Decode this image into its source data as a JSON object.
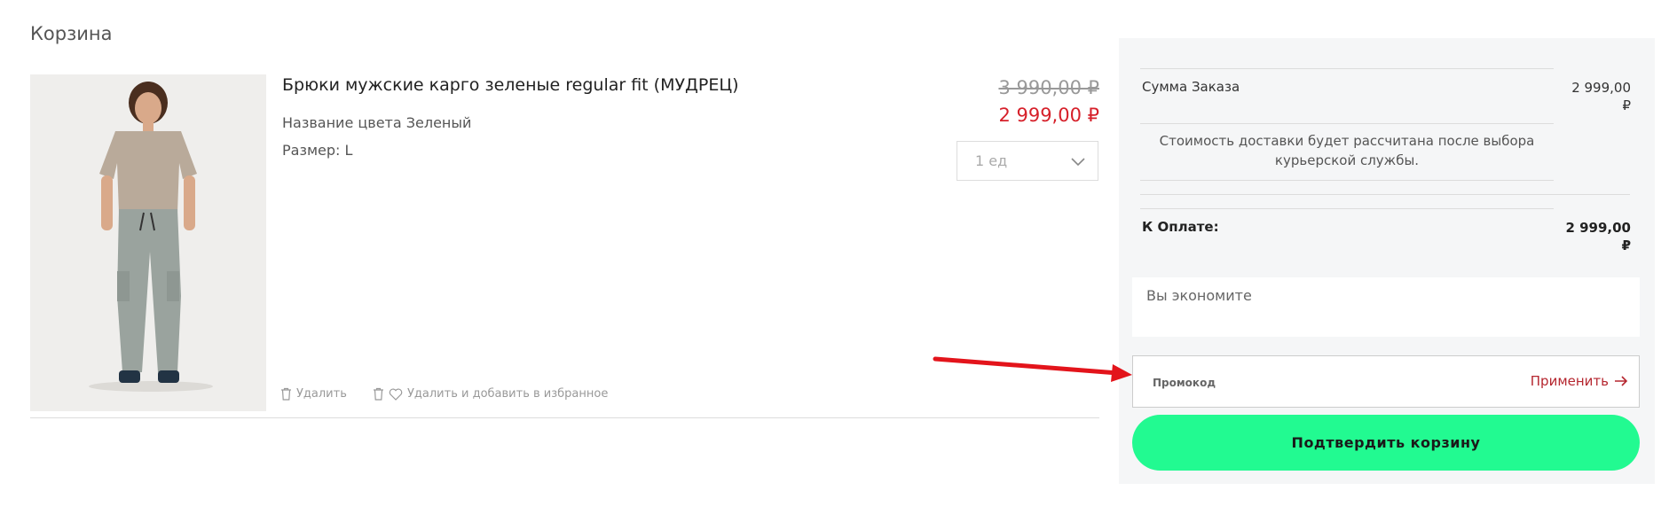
{
  "page": {
    "title": "Корзина"
  },
  "product": {
    "name": "Брюки мужские карго зеленые regular fit (МУДРЕЦ)",
    "color_line": "Название цвета Зеленый",
    "size_line": "Размер: L",
    "old_price": "3 990,00 ₽",
    "new_price": "2 999,00 ₽",
    "quantity": "1 ед",
    "delete_label": "Удалить",
    "delete_fav_label": "Удалить и добавить в избранное"
  },
  "summary": {
    "order_sum_label": "Сумма Заказа",
    "order_sum_value": "2 999,00 ₽",
    "delivery_note": "Стоимость доставки будет рассчитана после выбора курьерской службы.",
    "total_label": "К Оплате:",
    "total_value": "2 999,00 ₽",
    "savings_label": "Вы экономите",
    "promo_placeholder": "Промокод",
    "apply_label": "Применить",
    "confirm_label": "Подтвердить корзину"
  },
  "colors": {
    "accent_green": "#22fa91",
    "price_red": "#d6202a",
    "apply_red": "#b5262f",
    "annotation_arrow": "#e3141b"
  },
  "icons": {
    "trash": "trash-icon",
    "heart": "heart-icon",
    "chevron": "chevron-down-icon",
    "arrow": "arrow-right-icon"
  }
}
